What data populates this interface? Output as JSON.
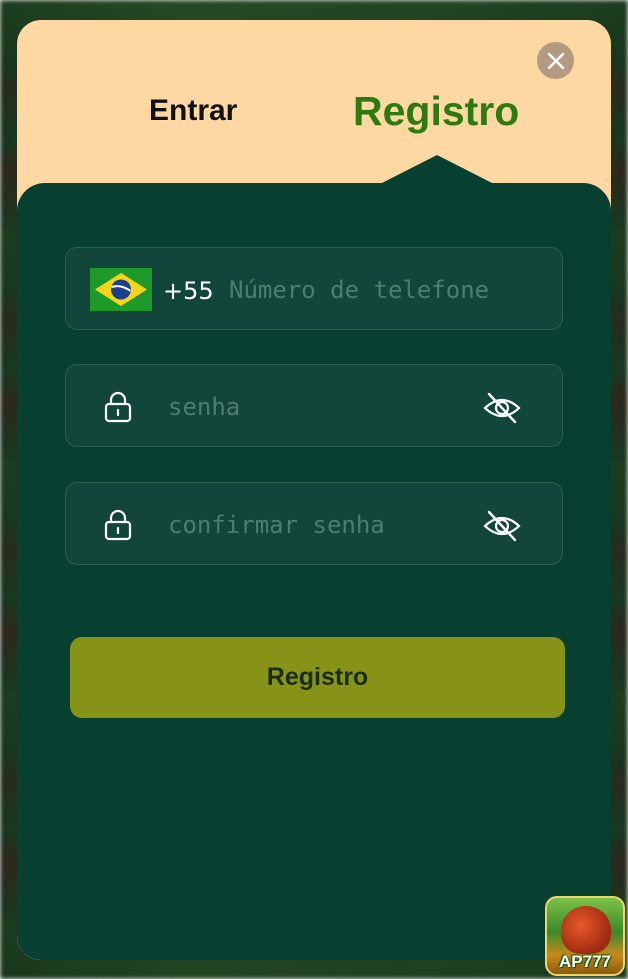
{
  "tabs": {
    "login_label": "Entrar",
    "register_label": "Registro"
  },
  "colors": {
    "header_bg": "#fdd8a3",
    "panel_bg": "#073f31",
    "active_tab": "#2f7a10",
    "submit_bg": "#869317"
  },
  "phone_field": {
    "country_flag": "brazil-flag-icon",
    "country_code": "+55",
    "placeholder": "Número de telefone",
    "value": ""
  },
  "password_field": {
    "placeholder": "senha",
    "value": ""
  },
  "confirm_password_field": {
    "placeholder": "confirmar senha",
    "value": ""
  },
  "submit": {
    "label": "Registro"
  },
  "app_logo": {
    "text": "AP777"
  }
}
